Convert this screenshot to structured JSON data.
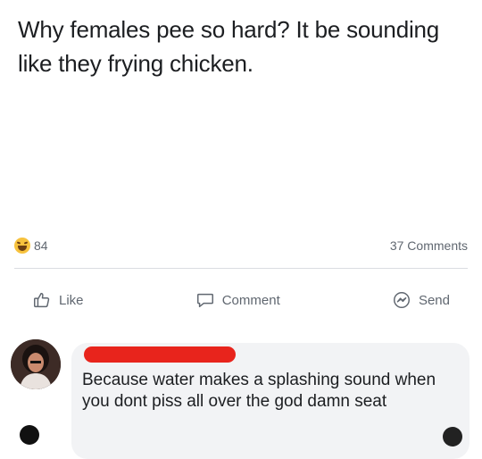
{
  "post": {
    "text": "Why females pee so hard? It be sounding like they frying chicken."
  },
  "stats": {
    "reaction_icon": "haha-emoji-icon",
    "reaction_count": "84",
    "comments_count": "37 Comments"
  },
  "actions": {
    "like_label": "Like",
    "comment_label": "Comment",
    "send_label": "Send"
  },
  "comment": {
    "text": "Because water makes a splashing sound when you dont piss all over the god damn seat"
  },
  "colors": {
    "redaction": "#e8241c",
    "bubble": "#f2f3f5",
    "secondary_text": "#606770"
  }
}
